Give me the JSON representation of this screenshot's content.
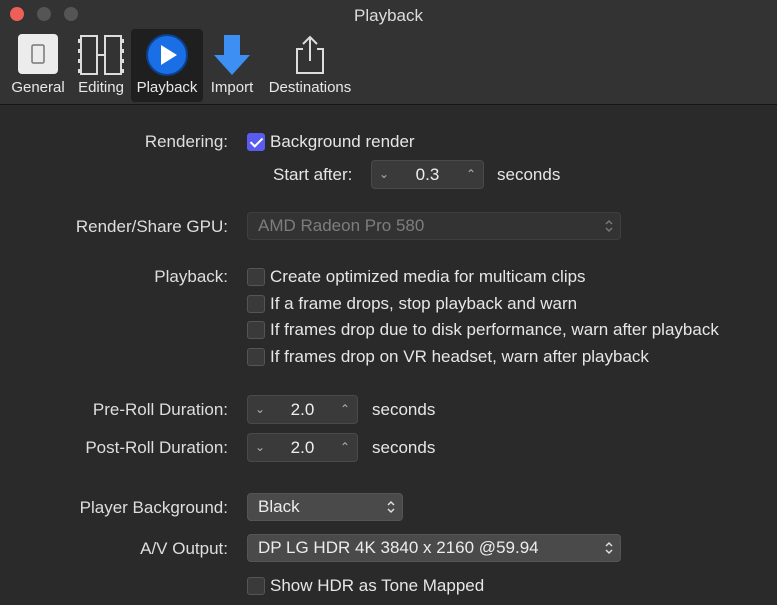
{
  "window": {
    "title": "Playback"
  },
  "toolbar": {
    "general": "General",
    "editing": "Editing",
    "playback": "Playback",
    "import": "Import",
    "destinations": "Destinations"
  },
  "rendering": {
    "label": "Rendering:",
    "background_render_label": "Background render",
    "background_render_checked": true,
    "start_after_label": "Start after:",
    "start_after_value": "0.3",
    "seconds": "seconds"
  },
  "gpu": {
    "label": "Render/Share GPU:",
    "value": "AMD Radeon Pro 580"
  },
  "playback": {
    "label": "Playback:",
    "options": [
      {
        "label": "Create optimized media for multicam clips",
        "checked": false
      },
      {
        "label": "If a frame drops, stop playback and warn",
        "checked": false
      },
      {
        "label": "If frames drop due to disk performance, warn after playback",
        "checked": false
      },
      {
        "label": "If frames drop on VR headset, warn after playback",
        "checked": false
      }
    ]
  },
  "preroll": {
    "label": "Pre-Roll Duration:",
    "value": "2.0",
    "unit": "seconds"
  },
  "postroll": {
    "label": "Post-Roll Duration:",
    "value": "2.0",
    "unit": "seconds"
  },
  "player_background": {
    "label": "Player Background:",
    "value": "Black"
  },
  "av_output": {
    "label": "A/V Output:",
    "value": "DP LG HDR 4K 3840 x 2160 @59.94"
  },
  "hdr": {
    "label": "Show HDR as Tone Mapped",
    "checked": false
  },
  "colors": {
    "accent": "#5a5cf1",
    "close": "#ee5f57"
  },
  "icons": {
    "stepper_down": "⌄",
    "stepper_up": "⌃"
  }
}
